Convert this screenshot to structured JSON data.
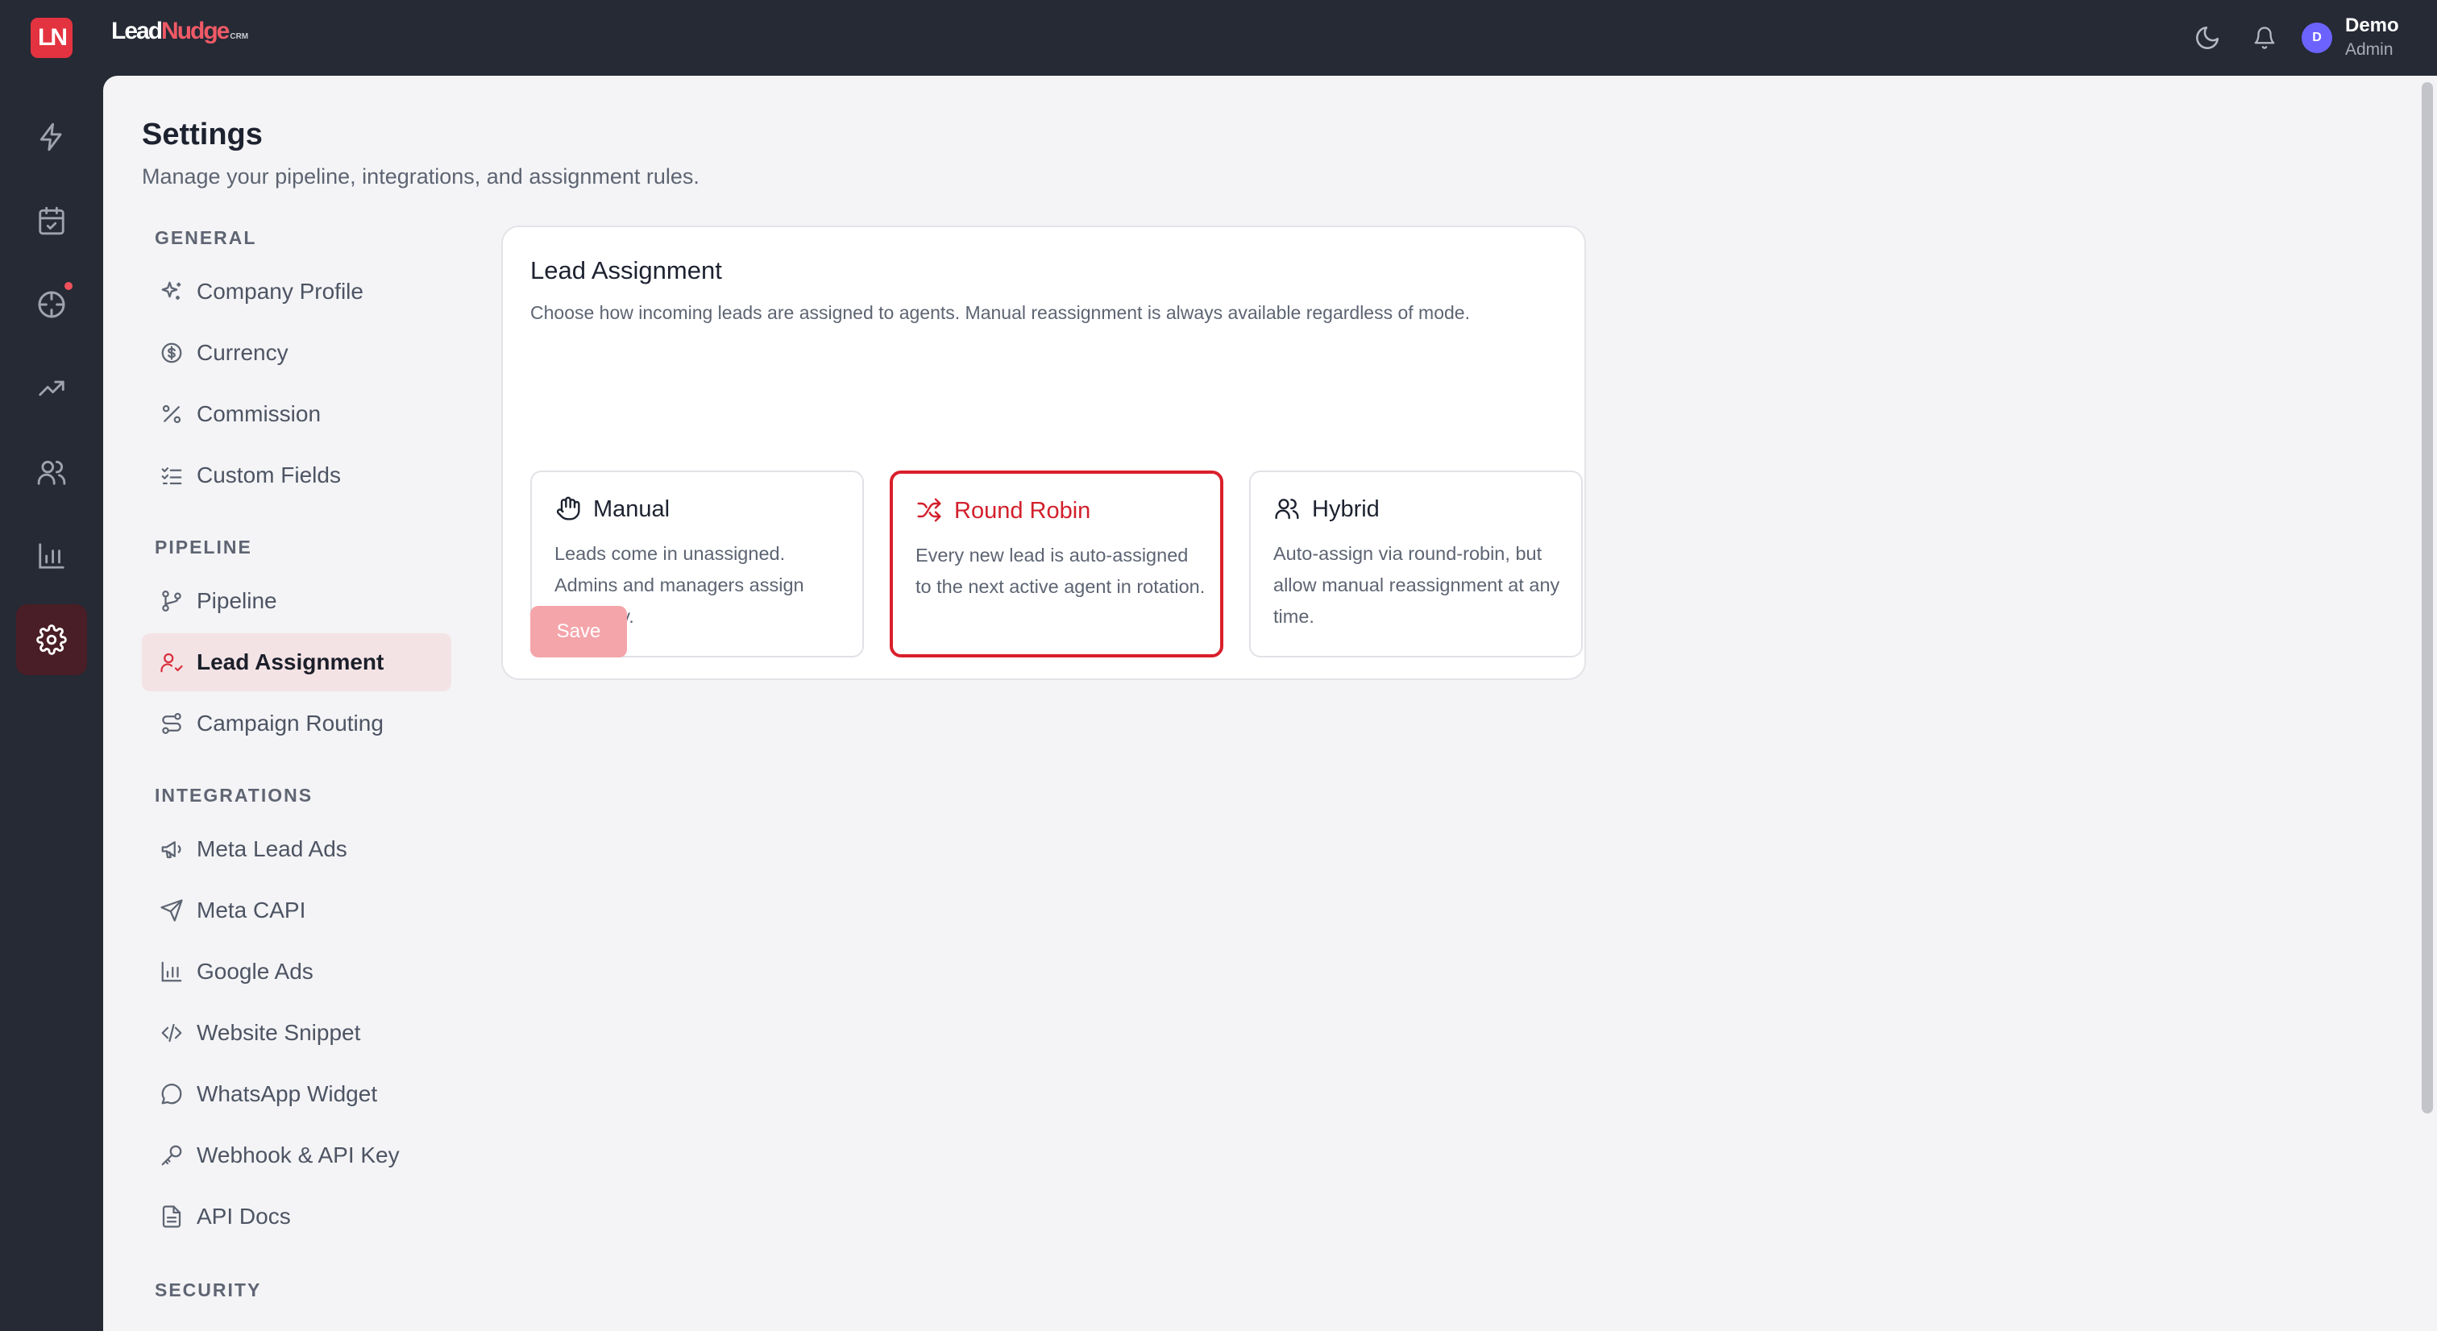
{
  "app": {
    "logo_text": "LN",
    "brand_part1": "Lead",
    "brand_part2": "Nudge",
    "brand_suffix": "CRM",
    "accent_color": "#e33340"
  },
  "topbar": {
    "icons": [
      "moon-icon",
      "bell-icon"
    ],
    "user": {
      "initial": "D",
      "name": "Demo",
      "role": "Admin"
    }
  },
  "rail": {
    "items": [
      {
        "icon": "bolt-icon",
        "active": false
      },
      {
        "icon": "calendar-check-icon",
        "active": false
      },
      {
        "icon": "crosshair-icon",
        "active": false,
        "notification": true
      },
      {
        "icon": "trending-up-icon",
        "active": false
      },
      {
        "icon": "users-icon",
        "active": false
      },
      {
        "icon": "bar-chart-icon",
        "active": false
      },
      {
        "icon": "settings-icon",
        "active": true
      }
    ]
  },
  "page": {
    "title": "Settings",
    "subtitle": "Manage your pipeline, integrations, and assignment rules."
  },
  "settings_nav": {
    "general": {
      "heading": "GENERAL",
      "items": [
        {
          "label": "Company Profile",
          "icon": "sparkles-icon"
        },
        {
          "label": "Currency",
          "icon": "dollar-circle-icon"
        },
        {
          "label": "Commission",
          "icon": "percent-icon"
        },
        {
          "label": "Custom Fields",
          "icon": "list-checks-icon"
        }
      ]
    },
    "pipeline": {
      "heading": "PIPELINE",
      "items": [
        {
          "label": "Pipeline",
          "icon": "git-branch-icon"
        },
        {
          "label": "Lead Assignment",
          "icon": "user-check-icon",
          "active": true
        },
        {
          "label": "Campaign Routing",
          "icon": "route-icon"
        }
      ]
    },
    "integrations": {
      "heading": "INTEGRATIONS",
      "items": [
        {
          "label": "Meta Lead Ads",
          "icon": "megaphone-icon"
        },
        {
          "label": "Meta CAPI",
          "icon": "send-icon"
        },
        {
          "label": "Google Ads",
          "icon": "bar-chart-icon"
        },
        {
          "label": "Website Snippet",
          "icon": "code-icon"
        },
        {
          "label": "WhatsApp Widget",
          "icon": "message-circle-icon"
        },
        {
          "label": "Webhook & API Key",
          "icon": "key-icon"
        },
        {
          "label": "API Docs",
          "icon": "file-text-icon"
        }
      ]
    },
    "security": {
      "heading": "SECURITY"
    }
  },
  "lead_assignment": {
    "title": "Lead Assignment",
    "description": "Choose how incoming leads are assigned to agents. Manual reassignment is always available regardless of mode.",
    "options": [
      {
        "title": "Manual",
        "description": "Leads come in unassigned. Admins and managers assign manually.",
        "icon": "hand-icon",
        "selected": false
      },
      {
        "title": "Round Robin",
        "description": "Every new lead is auto-assigned to the next active agent in rotation.",
        "icon": "shuffle-icon",
        "selected": true
      },
      {
        "title": "Hybrid",
        "description": "Auto-assign via round-robin, but allow manual reassignment at any time.",
        "icon": "users-icon",
        "selected": false
      }
    ],
    "save_label": "Save"
  }
}
